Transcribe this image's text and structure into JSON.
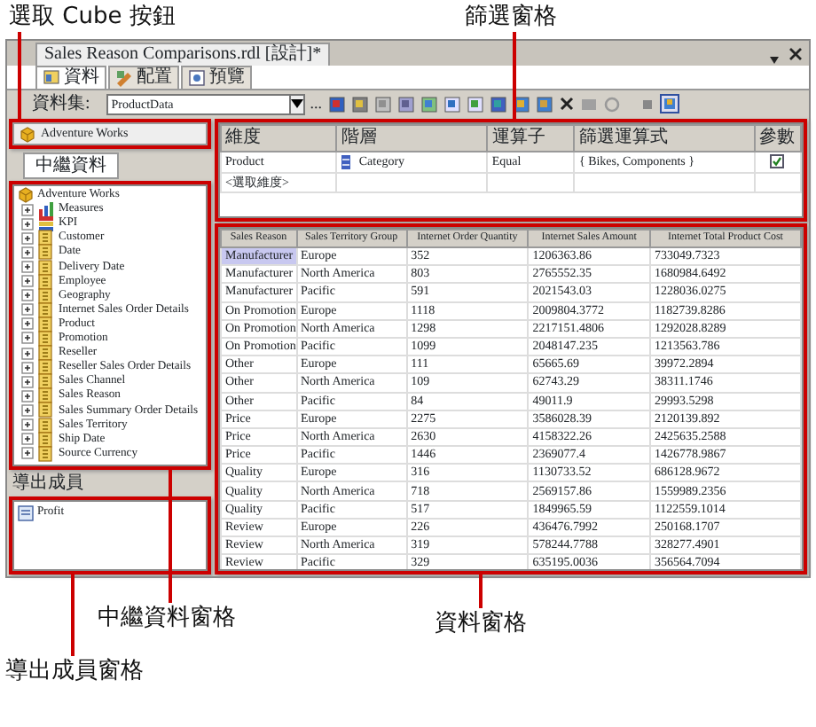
{
  "callouts": [
    {
      "text": "選取 Cube 按鈕"
    },
    {
      "text": "篩選窗格"
    },
    {
      "text": "中繼資料窗格"
    },
    {
      "text": "資料窗格"
    },
    {
      "text": "導出成員窗格"
    }
  ],
  "window": {
    "title": "Sales Reason Comparisons.rdl [設計]*"
  },
  "tabs": [
    {
      "label": "資料",
      "selected": true
    },
    {
      "label": "配置",
      "selected": false
    },
    {
      "label": "預覽",
      "selected": false
    }
  ],
  "toolbar": {
    "dataset_label": "資料集:",
    "dataset": "ProductData",
    "ellipsis": "..."
  },
  "cube": {
    "name": "Adventure Works"
  },
  "metadata_tab": {
    "label": "中繼資料"
  },
  "tree": {
    "root": "Adventure Works",
    "children": [
      {
        "label": "Measures",
        "kind": "measure",
        "expanded": false
      },
      {
        "label": "KPI",
        "kind": "kpi",
        "expanded": false
      },
      {
        "label": "Customer",
        "kind": "dimension",
        "expanded": false
      },
      {
        "label": "Date",
        "kind": "dimension",
        "expanded": false
      },
      {
        "label": "Delivery Date",
        "kind": "dimension",
        "expanded": false
      },
      {
        "label": "Employee",
        "kind": "dimension",
        "expanded": false
      },
      {
        "label": "Geography",
        "kind": "dimension",
        "expanded": false
      },
      {
        "label": "Internet Sales Order Details",
        "kind": "dimension",
        "expanded": false
      },
      {
        "label": "Product",
        "kind": "dimension",
        "expanded": false
      },
      {
        "label": "Promotion",
        "kind": "dimension",
        "expanded": false
      },
      {
        "label": "Reseller",
        "kind": "dimension",
        "expanded": false
      },
      {
        "label": "Reseller Sales Order Details",
        "kind": "dimension",
        "expanded": false
      },
      {
        "label": "Sales Channel",
        "kind": "dimension",
        "expanded": false
      },
      {
        "label": "Sales Reason",
        "kind": "dimension",
        "expanded": false
      },
      {
        "label": "Sales Summary Order Details",
        "kind": "dimension",
        "expanded": false
      },
      {
        "label": "Sales Territory",
        "kind": "dimension",
        "expanded": false
      },
      {
        "label": "Ship Date",
        "kind": "dimension",
        "expanded": false
      },
      {
        "label": "Source Currency",
        "kind": "dimension",
        "expanded": false
      }
    ]
  },
  "derived_members": {
    "header": "導出成員",
    "items": [
      "Profit"
    ]
  },
  "filter": {
    "columns": [
      "維度",
      "階層",
      "運算子",
      "篩選運算式",
      "參數"
    ],
    "rows": [
      {
        "dimension": "Product",
        "hierarchy": "Category",
        "operator": "Equal",
        "expression": "{ Bikes, Components }",
        "parameter": true
      }
    ],
    "new_row": "<選取維度>"
  },
  "data": {
    "columns": [
      "Sales Reason",
      "Sales Territory Group",
      "Internet Order Quantity",
      "Internet Sales Amount",
      "Internet Total Product Cost"
    ],
    "rows": [
      {
        "cells": [
          "Manufacturer",
          "Europe",
          "352",
          "1206363.86",
          "733049.7323"
        ],
        "selected": true
      },
      {
        "cells": [
          "Manufacturer",
          "North America",
          "803",
          "2765552.35",
          "1680984.6492"
        ],
        "selected": false
      },
      {
        "cells": [
          "Manufacturer",
          "Pacific",
          "591",
          "2021543.03",
          "1228036.0275"
        ],
        "selected": false
      },
      {
        "cells": [
          "On Promotion",
          "Europe",
          "1118",
          "2009804.3772",
          "1182739.8286"
        ],
        "selected": false
      },
      {
        "cells": [
          "On Promotion",
          "North America",
          "1298",
          "2217151.4806",
          "1292028.8289"
        ],
        "selected": false
      },
      {
        "cells": [
          "On Promotion",
          "Pacific",
          "1099",
          "2048147.235",
          "1213563.786"
        ],
        "selected": false
      },
      {
        "cells": [
          "Other",
          "Europe",
          "111",
          "65665.69",
          "39972.2894"
        ],
        "selected": false
      },
      {
        "cells": [
          "Other",
          "North America",
          "109",
          "62743.29",
          "38311.1746"
        ],
        "selected": false
      },
      {
        "cells": [
          "Other",
          "Pacific",
          "84",
          "49011.9",
          "29993.5298"
        ],
        "selected": false
      },
      {
        "cells": [
          "Price",
          "Europe",
          "2275",
          "3586028.39",
          "2120139.892"
        ],
        "selected": false
      },
      {
        "cells": [
          "Price",
          "North America",
          "2630",
          "4158322.26",
          "2425635.2588"
        ],
        "selected": false
      },
      {
        "cells": [
          "Price",
          "Pacific",
          "1446",
          "2369077.4",
          "1426778.9867"
        ],
        "selected": false
      },
      {
        "cells": [
          "Quality",
          "Europe",
          "316",
          "1130733.52",
          "686128.9672"
        ],
        "selected": false
      },
      {
        "cells": [
          "Quality",
          "North America",
          "718",
          "2569157.86",
          "1559989.2356"
        ],
        "selected": false
      },
      {
        "cells": [
          "Quality",
          "Pacific",
          "517",
          "1849965.59",
          "1122559.1014"
        ],
        "selected": false
      },
      {
        "cells": [
          "Review",
          "Europe",
          "226",
          "436476.7992",
          "250168.1707"
        ],
        "selected": false
      },
      {
        "cells": [
          "Review",
          "North America",
          "319",
          "578244.7788",
          "328277.4901"
        ],
        "selected": false
      },
      {
        "cells": [
          "Review",
          "Pacific",
          "329",
          "635195.0036",
          "356564.7094"
        ],
        "selected": false
      }
    ]
  }
}
